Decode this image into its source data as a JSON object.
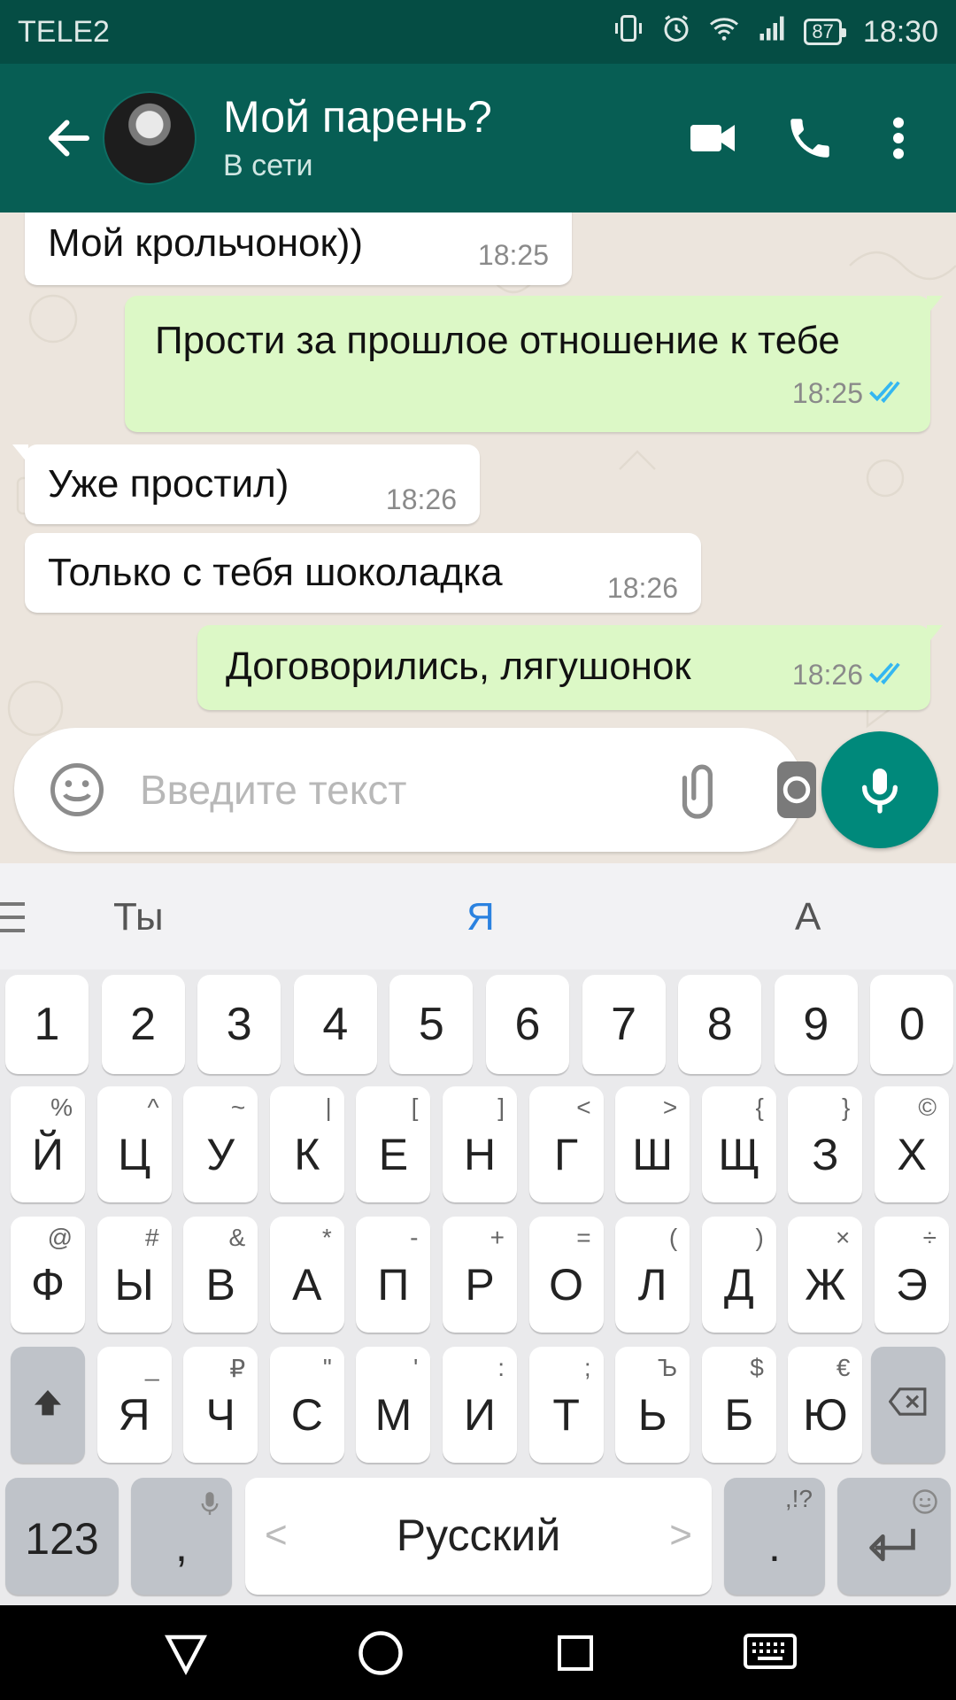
{
  "status_bar": {
    "carrier": "TELE2",
    "battery": "87",
    "time": "18:30"
  },
  "header": {
    "contact_name": "Мой парень?",
    "contact_status": "В сети"
  },
  "messages": [
    {
      "direction": "in",
      "text": "Мой крольчонок))",
      "time": "18:25"
    },
    {
      "direction": "out",
      "text": "Прости за прошлое отношение к тебе",
      "time": "18:25",
      "read": true
    },
    {
      "direction": "in",
      "text": "Уже простил)",
      "time": "18:26"
    },
    {
      "direction": "in",
      "text": "Только с тебя шоколадка",
      "time": "18:26"
    },
    {
      "direction": "out",
      "text": "Договорились, лягушонок",
      "time": "18:26",
      "read": true
    }
  ],
  "compose": {
    "placeholder": "Введите текст"
  },
  "keyboard": {
    "suggestions": [
      "Ты",
      "Я",
      "А"
    ],
    "number_row": [
      "1",
      "2",
      "3",
      "4",
      "5",
      "6",
      "7",
      "8",
      "9",
      "0"
    ],
    "row1": [
      {
        "key": "Й",
        "hint": "%"
      },
      {
        "key": "Ц",
        "hint": "^"
      },
      {
        "key": "У",
        "hint": "~"
      },
      {
        "key": "К",
        "hint": "|"
      },
      {
        "key": "Е",
        "hint": "["
      },
      {
        "key": "Н",
        "hint": "]"
      },
      {
        "key": "Г",
        "hint": "<"
      },
      {
        "key": "Ш",
        "hint": ">"
      },
      {
        "key": "Щ",
        "hint": "{"
      },
      {
        "key": "З",
        "hint": "}"
      },
      {
        "key": "Х",
        "hint": "©"
      }
    ],
    "row2": [
      {
        "key": "Ф",
        "hint": "@"
      },
      {
        "key": "Ы",
        "hint": "#"
      },
      {
        "key": "В",
        "hint": "&"
      },
      {
        "key": "А",
        "hint": "*"
      },
      {
        "key": "П",
        "hint": "-"
      },
      {
        "key": "Р",
        "hint": "+"
      },
      {
        "key": "О",
        "hint": "="
      },
      {
        "key": "Л",
        "hint": "("
      },
      {
        "key": "Д",
        "hint": ")"
      },
      {
        "key": "Ж",
        "hint": "×"
      },
      {
        "key": "Э",
        "hint": "÷"
      }
    ],
    "row3": [
      {
        "key": "Я",
        "hint": "_"
      },
      {
        "key": "Ч",
        "hint": "₽"
      },
      {
        "key": "С",
        "hint": "\""
      },
      {
        "key": "М",
        "hint": "'"
      },
      {
        "key": "И",
        "hint": ":"
      },
      {
        "key": "Т",
        "hint": ";"
      },
      {
        "key": "Ь",
        "hint": "Ъ"
      },
      {
        "key": "Б",
        "hint": "$"
      },
      {
        "key": "Ю",
        "hint": "€"
      }
    ],
    "numbers_key": "123",
    "comma_key": ",",
    "space_label": "Русский",
    "period_key": ".",
    "period_hint": ",!?",
    "space_left": "<",
    "space_right": ">"
  },
  "colors": {
    "header": "#075e54",
    "status_bar": "#054d44",
    "incoming": "#ffffff",
    "outgoing": "#dcf8c6",
    "read_ticks": "#34b7f1",
    "accent": "#00897b"
  }
}
